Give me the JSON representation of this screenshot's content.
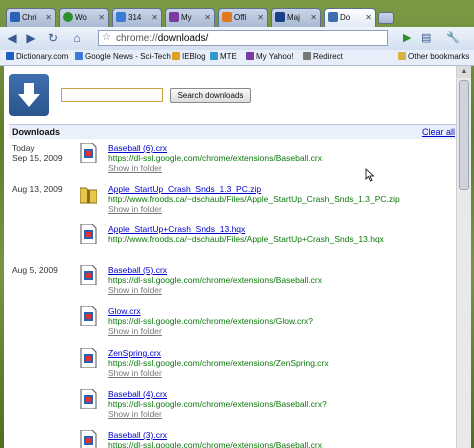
{
  "tabs": [
    {
      "title": "Chri",
      "favicon_color": "#2a62b8"
    },
    {
      "title": "Wo",
      "favicon_color": "#2f8f2f"
    },
    {
      "title": "314",
      "favicon_color": "#3b7bd6"
    },
    {
      "title": "My",
      "favicon_color": "#7a3aa0"
    },
    {
      "title": "Offi",
      "favicon_color": "#e07a1c"
    },
    {
      "title": "Maj",
      "favicon_color": "#1b3f8a"
    },
    {
      "title": "Do",
      "favicon_color": "#3f6fae"
    }
  ],
  "toolbar": {
    "url_scheme": "chrome://",
    "url_path": "downloads/"
  },
  "bookmarks": [
    {
      "label": "Dictionary.com",
      "color": "#1f5fbf"
    },
    {
      "label": "Google News - Sci-Tech",
      "color": "#3b7bd6"
    },
    {
      "label": "IEBlog",
      "color": "#e0a020"
    },
    {
      "label": "MTE",
      "color": "#3399cc"
    },
    {
      "label": "My Yahoo!",
      "color": "#7a3aa0"
    },
    {
      "label": "Redirect",
      "color": "#777777"
    },
    {
      "label": "Other bookmarks",
      "color": "#d6b24a"
    }
  ],
  "search": {
    "input_value": "",
    "button_label": "Search downloads"
  },
  "downloads": {
    "header": "Downloads",
    "clear_all": "Clear all",
    "show_in_folder": "Show in folder",
    "groups": [
      {
        "date_line1": "Today",
        "date_line2": "Sep 15, 2009"
      },
      {
        "date_line1": "Aug 13, 2009",
        "date_line2": ""
      },
      {
        "date_line1": "Aug 5, 2009",
        "date_line2": ""
      }
    ],
    "items": [
      {
        "name": "Baseball (6).crx",
        "url": "https://dl-ssl.google.com/chrome/extensions/Baseball.crx",
        "icon": "crx-file-icon"
      },
      {
        "name": "Apple_StartUp_Crash_Snds_1.3_PC.zip",
        "url": "http://www.froods.ca/~dschaub/Files/Apple_StartUp_Crash_Snds_1.3_PC.zip",
        "icon": "zip-folder-icon"
      },
      {
        "name": "Apple_StartUp+Crash_Snds_13.hqx",
        "url": "http://www.froods.ca/~dschaub/Files/Apple_StartUp+Crash_Snds_13.hqx",
        "icon": "crx-file-icon"
      },
      {
        "name": "Baseball (5).crx",
        "url": "https://dl-ssl.google.com/chrome/extensions/Baseball.crx",
        "icon": "crx-file-icon"
      },
      {
        "name": "Glow.crx",
        "url": "https://dl-ssl.google.com/chrome/extensions/Glow.crx?",
        "icon": "crx-file-icon"
      },
      {
        "name": "ZenSpring.crx",
        "url": "https://dl-ssl.google.com/chrome/extensions/ZenSpring.crx",
        "icon": "crx-file-icon"
      },
      {
        "name": "Baseball (4).crx",
        "url": "https://dl-ssl.google.com/chrome/extensions/Baseball.crx?",
        "icon": "crx-file-icon"
      },
      {
        "name": "Baseball (3).crx",
        "url": "https://dl-ssl.google.com/chrome/extensions/Baseball.crx",
        "icon": "crx-file-icon"
      }
    ]
  }
}
